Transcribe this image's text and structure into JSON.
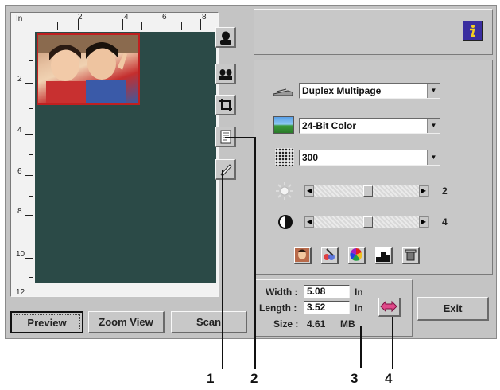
{
  "ruler": {
    "unit": "In",
    "top_numbers": [
      "2",
      "4",
      "6",
      "8"
    ],
    "left_numbers": [
      "2",
      "4",
      "6",
      "8",
      "10",
      "12"
    ]
  },
  "buttons": {
    "preview": "Preview",
    "zoom_view": "Zoom View",
    "scan": "Scan",
    "exit": "Exit"
  },
  "settings": {
    "scan_source": "Duplex Multipage",
    "image_type": "24-Bit Color",
    "resolution": "300",
    "brightness_value": "2",
    "contrast_value": "4"
  },
  "size_panel": {
    "width_label": "Width :",
    "width_value": "5.08",
    "width_unit": "In",
    "length_label": "Length :",
    "length_value": "3.52",
    "length_unit": "In",
    "size_label": "Size :",
    "size_value": "4.61",
    "size_unit": "MB"
  },
  "callouts": [
    "1",
    "2",
    "3",
    "4"
  ],
  "colors": {
    "window_bg": "#c4c4c4",
    "preview_bg": "#2b4a47",
    "scan_frame": "#c02020",
    "info_button": "#3a2ea0"
  }
}
